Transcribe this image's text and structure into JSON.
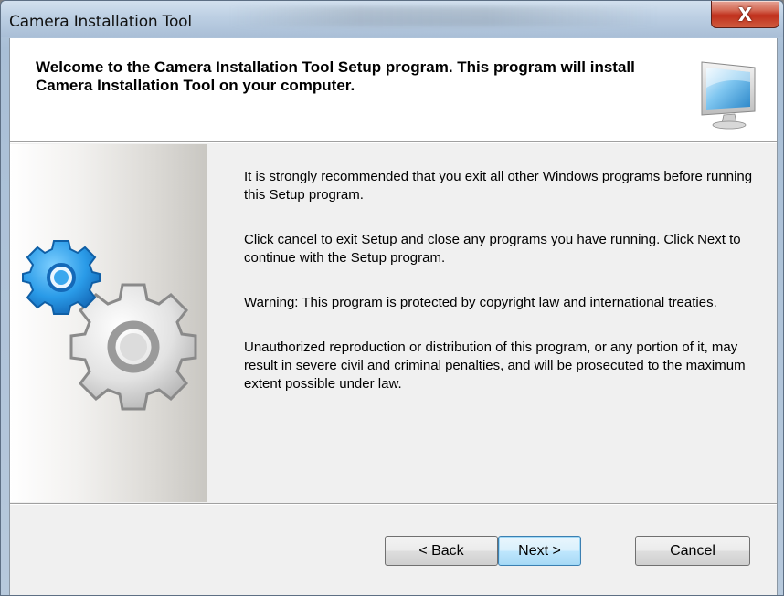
{
  "window": {
    "title": "Camera Installation Tool",
    "close_label": "X"
  },
  "header": {
    "welcome": "Welcome to the Camera Installation Tool Setup program. This program will install Camera Installation Tool on your computer."
  },
  "body": {
    "paragraphs": [
      "It is strongly recommended that you exit all other Windows programs before running this Setup program.",
      "Click cancel to exit Setup and close any programs you have running. Click Next to continue with the Setup program.",
      "Warning: This program is protected by copyright law and international treaties.",
      "Unauthorized reproduction or distribution of this program, or any portion of it, may result in severe civil and criminal penalties, and will be prosecuted to the maximum extent possible under law."
    ]
  },
  "buttons": {
    "back": "< Back",
    "next": "Next >",
    "cancel": "Cancel"
  },
  "icons": {
    "monitor": "monitor-icon",
    "gears": "gears-icon",
    "close": "close-icon"
  },
  "colors": {
    "blue_gear": "#1e8be0",
    "gray_gear": "#8c8c8c",
    "default_button_border": "#3c7fb1"
  }
}
